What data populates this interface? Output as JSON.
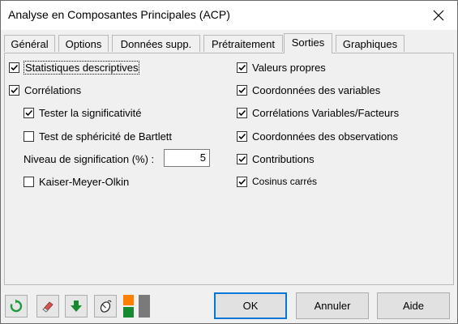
{
  "window": {
    "title": "Analyse en Composantes Principales (ACP)"
  },
  "tabs": [
    {
      "label": "Général"
    },
    {
      "label": "Options"
    },
    {
      "label": "Données supp."
    },
    {
      "label": "Prétraitement"
    },
    {
      "label": "Sorties",
      "active": true
    },
    {
      "label": "Graphiques"
    }
  ],
  "left_options": {
    "stats_desc": {
      "label": "Statistiques descriptives",
      "checked": true
    },
    "correlations": {
      "label": "Corrélations",
      "checked": true
    },
    "test_signif": {
      "label": "Tester la significativité",
      "checked": true
    },
    "bartlett": {
      "label": "Test de sphéricité de Bartlett",
      "checked": false
    },
    "signif_level": {
      "label": "Niveau de signification (%) :",
      "value": "5"
    },
    "kmo": {
      "label": "Kaiser-Meyer-Olkin",
      "checked": false
    }
  },
  "right_options": [
    {
      "label": "Valeurs propres",
      "checked": true
    },
    {
      "label": "Coordonnées des variables",
      "checked": true
    },
    {
      "label": "Corrélations Variables/Facteurs",
      "checked": true
    },
    {
      "label": "Coordonnées des observations",
      "checked": true
    },
    {
      "label": "Contributions",
      "checked": true
    },
    {
      "label": "Cosinus carrés",
      "checked": true
    }
  ],
  "buttons": {
    "ok": "OK",
    "cancel": "Annuler",
    "help": "Aide"
  },
  "toolbar_icons": [
    "reset-icon",
    "eraser-icon",
    "download-arrow-icon",
    "mouse-icon",
    "color-squares-icon"
  ],
  "colors": {
    "accent": "#0078d7",
    "reset_green": "#1a9b3c",
    "arrow_green": "#178a2f",
    "orange": "#ff7f00"
  }
}
